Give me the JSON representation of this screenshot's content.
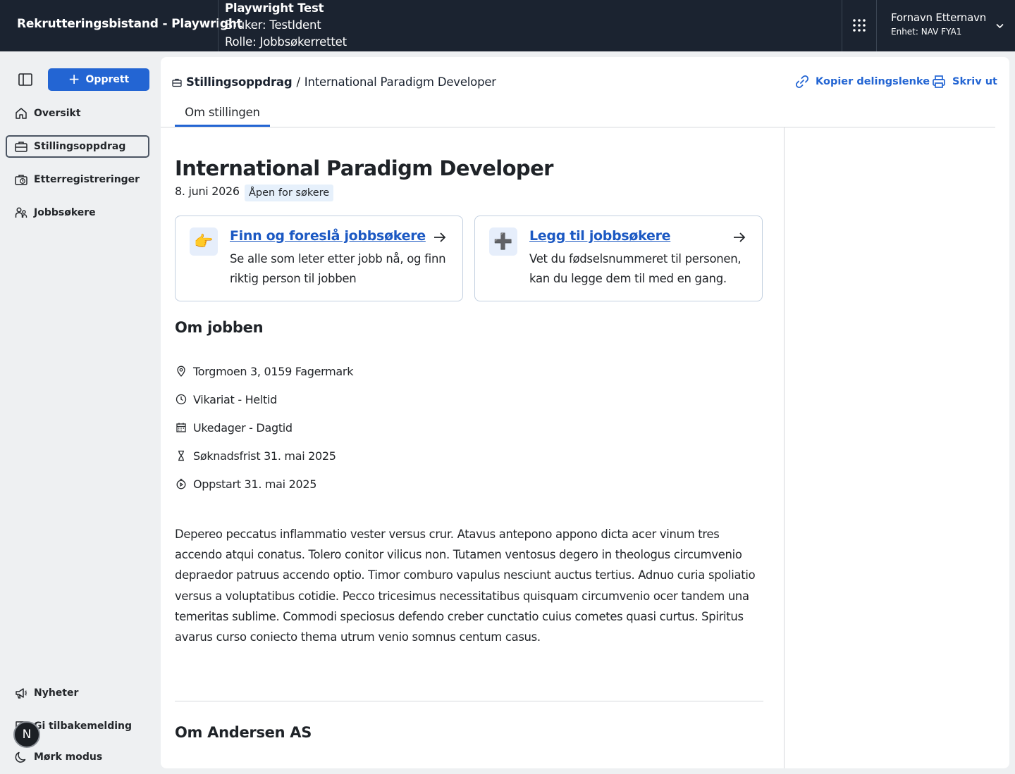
{
  "header": {
    "app_title": "Rekrutteringsbistand - Playwright",
    "test_title": "Playwright Test",
    "test_user": "Bruker: TestIdent",
    "test_role": "Rolle: Jobbsøkerrettet",
    "user_name": "Fornavn Etternavn",
    "user_unit": "Enhet: NAV FYA1"
  },
  "sidebar": {
    "create_label": "Opprett",
    "items": [
      {
        "label": "Oversikt",
        "icon": "home-icon"
      },
      {
        "label": "Stillingsoppdrag",
        "icon": "briefcase-icon",
        "active": true
      },
      {
        "label": "Etterregistreringer",
        "icon": "briefcase-clock-icon"
      },
      {
        "label": "Jobbsøkere",
        "icon": "people-icon"
      }
    ],
    "bottom": [
      {
        "label": "Nyheter",
        "icon": "megaphone-icon"
      },
      {
        "label": "Gi tilbakemelding",
        "icon": "chat-icon"
      },
      {
        "label": "Mørk modus",
        "icon": "moon-icon"
      }
    ],
    "avatar_letter": "N"
  },
  "main": {
    "breadcrumb": {
      "parent": "Stillingsoppdrag",
      "separator": "/",
      "current": "International Paradigm Developer"
    },
    "actions": {
      "copy_link": "Kopier delingslenke",
      "print": "Skriv ut"
    },
    "tab": "Om stillingen",
    "title": "International Paradigm Developer",
    "date": "8. juni 2026",
    "status": "Åpen for søkere",
    "cards": [
      {
        "emoji": "👉",
        "title": "Finn og foreslå jobbsøkere",
        "desc": "Se alle som leter etter jobb nå, og finn riktig person til jobben"
      },
      {
        "emoji": "➕",
        "title": "Legg til jobbsøkere",
        "desc": "Vet du fødselsnummeret til personen, kan du legge dem til med en gang."
      }
    ],
    "about_heading": "Om jobben",
    "facts": [
      {
        "icon": "location-pin-icon",
        "text": "Torgmoen 3, 0159 Fagermark"
      },
      {
        "icon": "clock-icon",
        "text": "Vikariat - Heltid"
      },
      {
        "icon": "calendar-icon",
        "text": "Ukedager - Dagtid"
      },
      {
        "icon": "hourglass-icon",
        "text": "Søknadsfrist 31. mai 2025"
      },
      {
        "icon": "timer-icon",
        "text": "Oppstart 31. mai 2025"
      }
    ],
    "description": "Depereo peccatus inflammatio vester versus crur. Atavus antepono appono dicta acer vinum tres accendo atqui conatus. Tolero conitor vilicus non. Tutamen ventosus degero in theologus circumvenio depraedor patruus accendo optio. Timor comburo vapulus nesciunt auctus tertius. Adnuo curia spoliatio versus a voluptatibus cotidie. Pecco tricesimus necessitatibus quisquam circumvenio ocer tandem una temeritas sublime. Commodi speciosus defendo creber cunctatio cuius cometes quasi curtus. Spiritus avarus curso coniecto thema utrum venio somnus centum casus.",
    "employer_heading": "Om Andersen AS"
  },
  "colors": {
    "header_bg": "#1b2330",
    "accent": "#2365d3",
    "page_bg": "#eef0f2"
  }
}
